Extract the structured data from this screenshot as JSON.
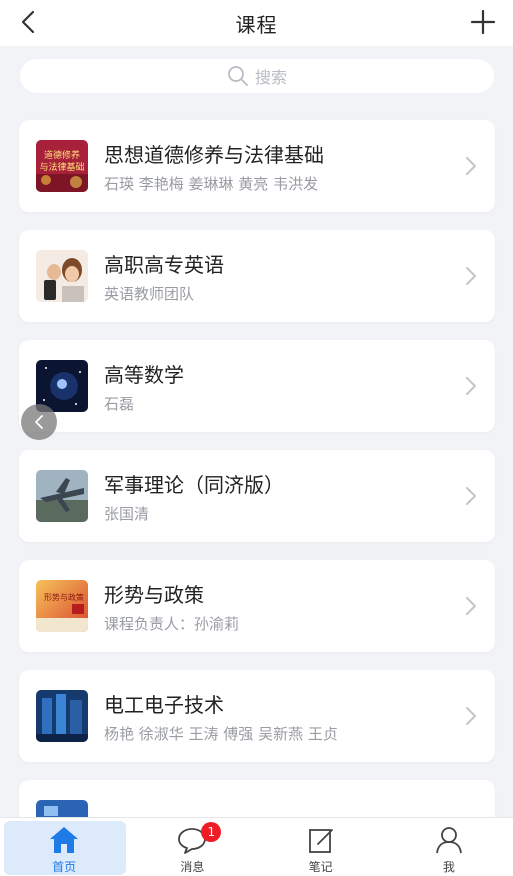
{
  "header": {
    "title": "课程",
    "back_icon": "chevron-left-icon",
    "add_icon": "plus-icon"
  },
  "search": {
    "placeholder": "搜索",
    "icon": "search-icon"
  },
  "courses": [
    {
      "name": "思想道德修养与法律基础",
      "teachers": "石瑛 李艳梅 姜琳琳 黄亮 韦洪发",
      "thumb_text": "道德修养\n与法律基础",
      "thumb_color": "#b0283a"
    },
    {
      "name": "高职高专英语",
      "teachers": "英语教师团队",
      "thumb_color": "#e9d7c6"
    },
    {
      "name": "高等数学",
      "teachers": "石磊",
      "thumb_color": "#0d1633"
    },
    {
      "name": "军事理论（同济版）",
      "teachers": "张国清",
      "thumb_color": "#6e8797"
    },
    {
      "name": "形势与政策",
      "teachers": "课程负责人：孙渝莉",
      "thumb_text": "形势与政策",
      "thumb_color": "#d6553a"
    },
    {
      "name": "电工电子技术",
      "teachers": "杨艳 徐淑华 王涛 傅强 吴新燕 王贞",
      "thumb_color": "#1c4f8f"
    }
  ],
  "tabbar": {
    "items": [
      {
        "label": "首页",
        "icon": "home-icon",
        "active": true
      },
      {
        "label": "消息",
        "icon": "chat-bubble-icon",
        "badge": "1"
      },
      {
        "label": "笔记",
        "icon": "note-edit-icon"
      },
      {
        "label": "我",
        "icon": "user-icon"
      }
    ]
  },
  "colors": {
    "accent": "#1f7be8",
    "background": "#f2f3f7",
    "badge": "#ee1c24"
  }
}
